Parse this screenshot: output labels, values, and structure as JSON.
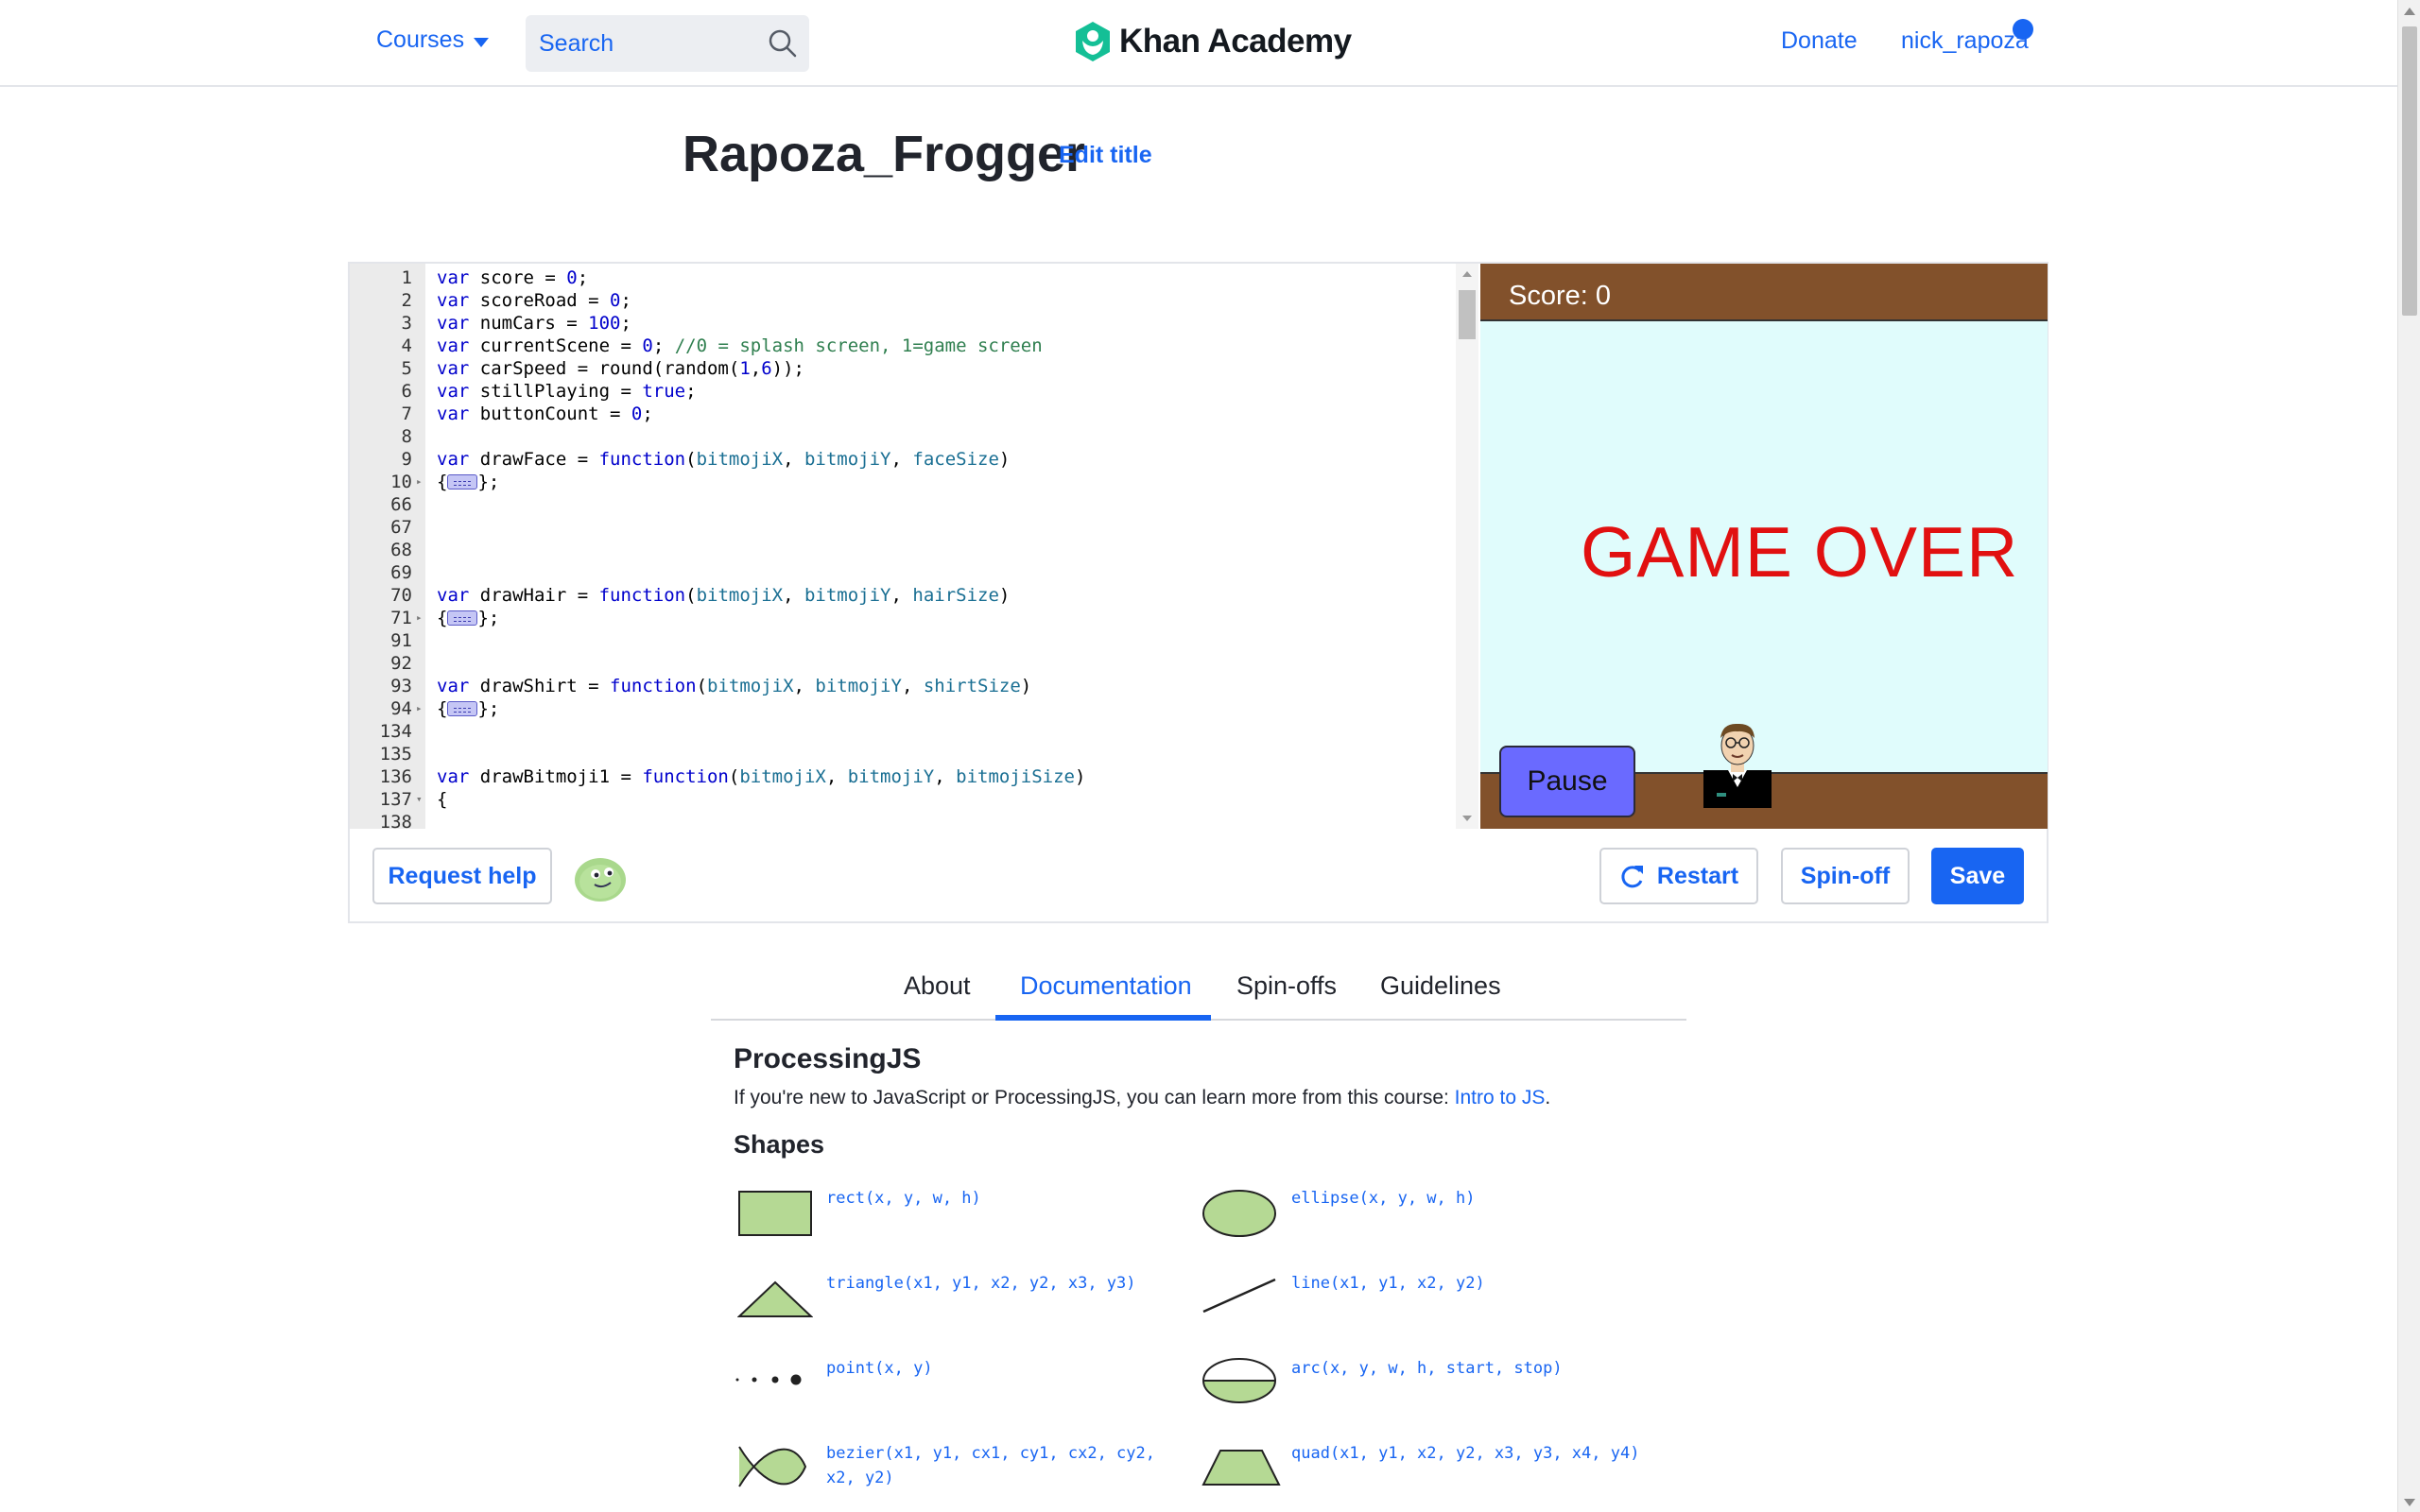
{
  "header": {
    "courses_label": "Courses",
    "search_placeholder": "Search",
    "logo_text": "Khan Academy",
    "donate_label": "Donate",
    "username": "nick_rapoza"
  },
  "page": {
    "title": "Rapoza_Frogger",
    "edit_title_label": "Edit title"
  },
  "editor": {
    "lines": [
      {
        "n": "1",
        "html": "<span class='kw'>var</span> score = <span class='num'>0</span>;"
      },
      {
        "n": "2",
        "html": "<span class='kw'>var</span> scoreRoad = <span class='num'>0</span>;"
      },
      {
        "n": "3",
        "html": "<span class='kw'>var</span> numCars = <span class='num'>100</span>;"
      },
      {
        "n": "4",
        "html": "<span class='kw'>var</span> currentScene = <span class='num'>0</span>; <span class='cm'>//0 = splash screen, 1=game screen</span>"
      },
      {
        "n": "5",
        "html": "<span class='kw'>var</span> carSpeed = round(random(<span class='num'>1</span>,<span class='num'>6</span>));"
      },
      {
        "n": "6",
        "html": "<span class='kw'>var</span> stillPlaying = <span class='bool'>true</span>;"
      },
      {
        "n": "7",
        "html": "<span class='kw'>var</span> buttonCount = <span class='num'>0</span>;"
      },
      {
        "n": "8",
        "html": ""
      },
      {
        "n": "9",
        "html": "<span class='kw'>var</span> drawFace = <span class='fn'>function</span>(<span class='par'>bitmojiX</span>, <span class='par'>bitmojiY</span>, <span class='par'>faceSize</span>)"
      },
      {
        "n": "10",
        "fold": "right",
        "html": "{<span class='fold-box'></span>};"
      },
      {
        "n": "66",
        "html": ""
      },
      {
        "n": "67",
        "html": ""
      },
      {
        "n": "68",
        "html": ""
      },
      {
        "n": "69",
        "html": ""
      },
      {
        "n": "70",
        "html": "<span class='kw'>var</span> drawHair = <span class='fn'>function</span>(<span class='par'>bitmojiX</span>, <span class='par'>bitmojiY</span>, <span class='par'>hairSize</span>)"
      },
      {
        "n": "71",
        "fold": "right",
        "html": "{<span class='fold-box'></span>};"
      },
      {
        "n": "91",
        "html": ""
      },
      {
        "n": "92",
        "html": ""
      },
      {
        "n": "93",
        "html": "<span class='kw'>var</span> drawShirt = <span class='fn'>function</span>(<span class='par'>bitmojiX</span>, <span class='par'>bitmojiY</span>, <span class='par'>shirtSize</span>)"
      },
      {
        "n": "94",
        "fold": "right",
        "html": "{<span class='fold-box'></span>};"
      },
      {
        "n": "134",
        "html": ""
      },
      {
        "n": "135",
        "html": ""
      },
      {
        "n": "136",
        "html": "<span class='kw'>var</span> drawBitmoji1 = <span class='fn'>function</span>(<span class='par'>bitmojiX</span>, <span class='par'>bitmojiY</span>, <span class='par'>bitmojiSize</span>)"
      },
      {
        "n": "137",
        "fold": "down",
        "html": "{"
      },
      {
        "n": "138",
        "html": ""
      }
    ]
  },
  "canvas": {
    "score_text": "Score: 0",
    "game_over_text": "GAME OVER",
    "pause_label": "Pause",
    "colors": {
      "road": "#82512b",
      "sky": "#e0fcfc",
      "game_over": "#e11010",
      "pause": "#6a6aff"
    }
  },
  "actions": {
    "request_help": "Request help",
    "restart": "Restart",
    "spinoff": "Spin-off",
    "save": "Save"
  },
  "tabs": [
    {
      "label": "About",
      "active": false
    },
    {
      "label": "Documentation",
      "active": true
    },
    {
      "label": "Spin-offs",
      "active": false
    },
    {
      "label": "Guidelines",
      "active": false
    }
  ],
  "docs": {
    "heading": "ProcessingJS",
    "intro_text": "If you're new to JavaScript or ProcessingJS, you can learn more from this course: ",
    "intro_link": "Intro to JS",
    "intro_end": ".",
    "shapes_heading": "Shapes",
    "shapes": [
      {
        "label": "rect(x, y, w, h)",
        "icon": "rect-shape-icon"
      },
      {
        "label": "ellipse(x, y, w, h)",
        "icon": "ellipse-shape-icon"
      },
      {
        "label": "triangle(x1, y1, x2, y2, x3, y3)",
        "icon": "triangle-shape-icon"
      },
      {
        "label": "line(x1, y1, x2, y2)",
        "icon": "line-shape-icon"
      },
      {
        "label": "point(x, y)",
        "icon": "point-shape-icon"
      },
      {
        "label": "arc(x, y, w, h, start, stop)",
        "icon": "arc-shape-icon"
      },
      {
        "label": "bezier(x1, y1, cx1, cy1, cx2, cy2, x2, y2)",
        "icon": "bezier-shape-icon"
      },
      {
        "label": "quad(x1, y1, x2, y2, x3, y3, x4, y4)",
        "icon": "quad-shape-icon"
      }
    ]
  },
  "accent_color": "#1865f2"
}
